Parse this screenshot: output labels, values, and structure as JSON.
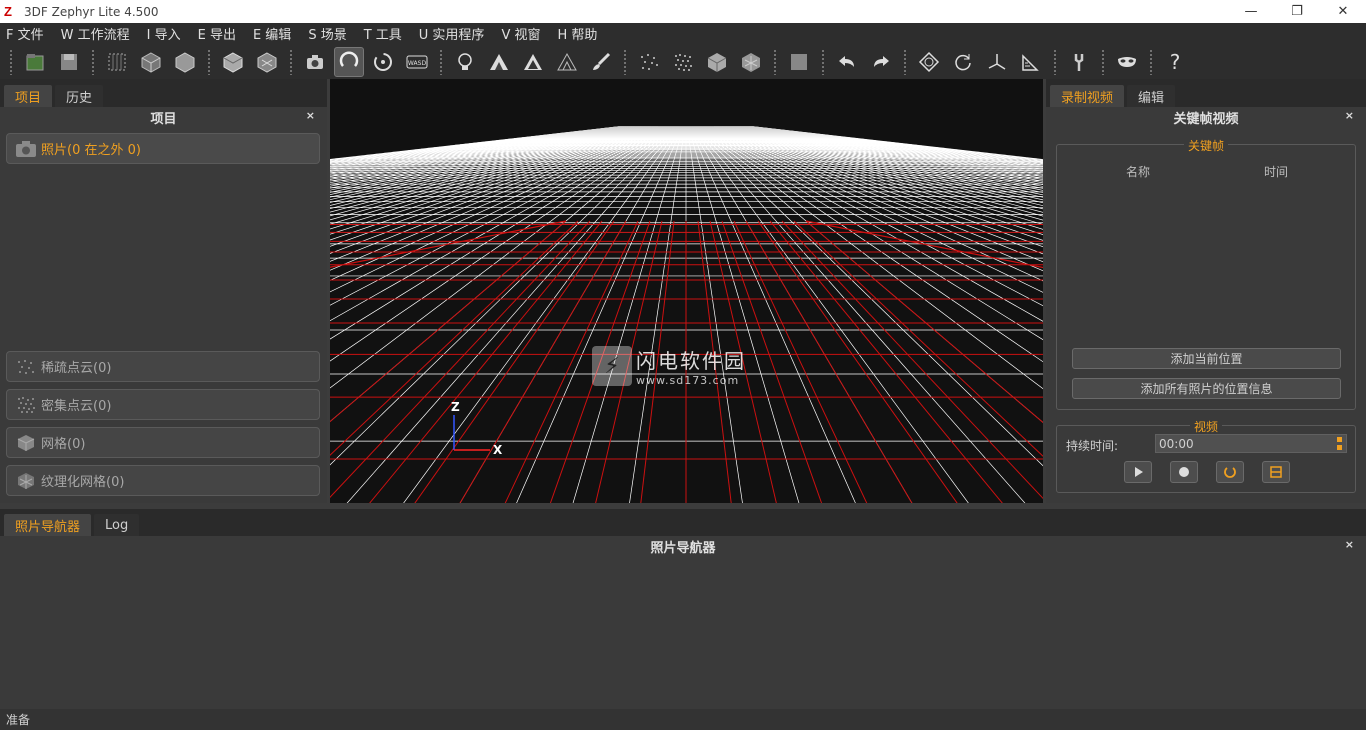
{
  "window": {
    "title": "3DF Zephyr Lite 4.500",
    "logo_letter": "Z",
    "controls": [
      "—",
      "❐",
      "✕"
    ]
  },
  "menu": [
    "F 文件",
    "W 工作流程",
    "I 导入",
    "E 导出",
    "E 编辑",
    "S 场景",
    "T 工具",
    "U 实用程序",
    "V 视窗",
    "H 帮助"
  ],
  "toolbar": {
    "help_label": "?",
    "wasd_label": "WASD"
  },
  "left_panel": {
    "tabs": [
      "项目",
      "历史"
    ],
    "active_tab": 0,
    "title": "项目",
    "close_label": "×",
    "items": [
      {
        "label": "照片(0 在之外 0)",
        "icon": "camera-icon",
        "highlight": true
      },
      {
        "label": "稀疏点云(0)",
        "icon": "sparse-cloud-icon"
      },
      {
        "label": "密集点云(0)",
        "icon": "dense-cloud-icon"
      },
      {
        "label": "网格(0)",
        "icon": "mesh-icon"
      },
      {
        "label": "纹理化网格(0)",
        "icon": "textured-mesh-icon"
      }
    ]
  },
  "viewport": {
    "watermark_title": "闪电软件园",
    "watermark_url": "www.sd173.com",
    "axis_z": "Z",
    "axis_x": "X",
    "colors": {
      "grid_white": "#ffffff",
      "grid_red": "#cc1111",
      "background": "#111111"
    }
  },
  "right_panel": {
    "tabs": [
      "录制视频",
      "编辑"
    ],
    "active_tab": 0,
    "title": "关键帧视频",
    "close_label": "×",
    "keyframes": {
      "group_title": "关键帧",
      "col_name": "名称",
      "col_time": "时间",
      "add_current_label": "添加当前位置",
      "add_all_label": "添加所有照片的位置信息"
    },
    "video": {
      "group_title": "视频",
      "duration_label": "持续时间:",
      "duration_value": "00:00"
    }
  },
  "bottom_panel": {
    "tabs": [
      "照片导航器",
      "Log"
    ],
    "active_tab": 0,
    "title": "照片导航器",
    "close_label": "×"
  },
  "status": "准备",
  "accent_color": "#f0a020"
}
